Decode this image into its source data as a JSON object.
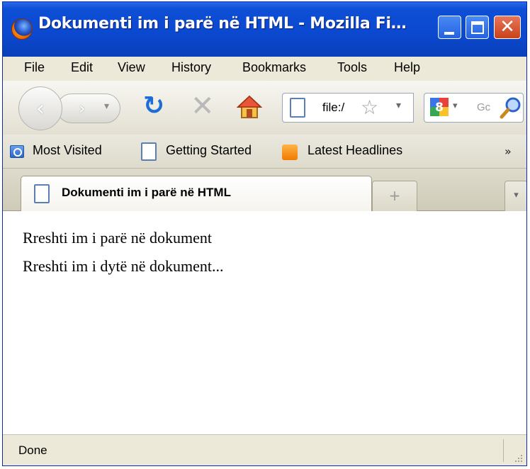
{
  "window": {
    "title": "Dokumenti im i parë në HTML - Mozilla Fi…"
  },
  "menu": {
    "items": [
      "File",
      "Edit",
      "View",
      "History",
      "Bookmarks",
      "Tools",
      "Help"
    ]
  },
  "navigation": {
    "url": "file:/",
    "search_placeholder": "Gc",
    "icons": [
      "back-icon",
      "forward-icon",
      "reload-icon",
      "stop-icon",
      "home-icon",
      "page-icon",
      "star-icon",
      "google-icon",
      "magnifier-icon"
    ]
  },
  "bookmarks": {
    "items": [
      "Most Visited",
      "Getting Started",
      "Latest Headlines"
    ],
    "more": "»"
  },
  "tabs": {
    "active_title": "Dokumenti im i parë në HTML",
    "new_tab": "+",
    "list": "▾"
  },
  "content": {
    "lines": [
      "Rreshti im i parë në dokument",
      "Rreshti im i dytë në dokument..."
    ]
  },
  "status": {
    "text": "Done"
  },
  "colors": {
    "titlebar": "#0b48d0",
    "reload": "#1d6dd8",
    "close_button": "#c9421b"
  }
}
